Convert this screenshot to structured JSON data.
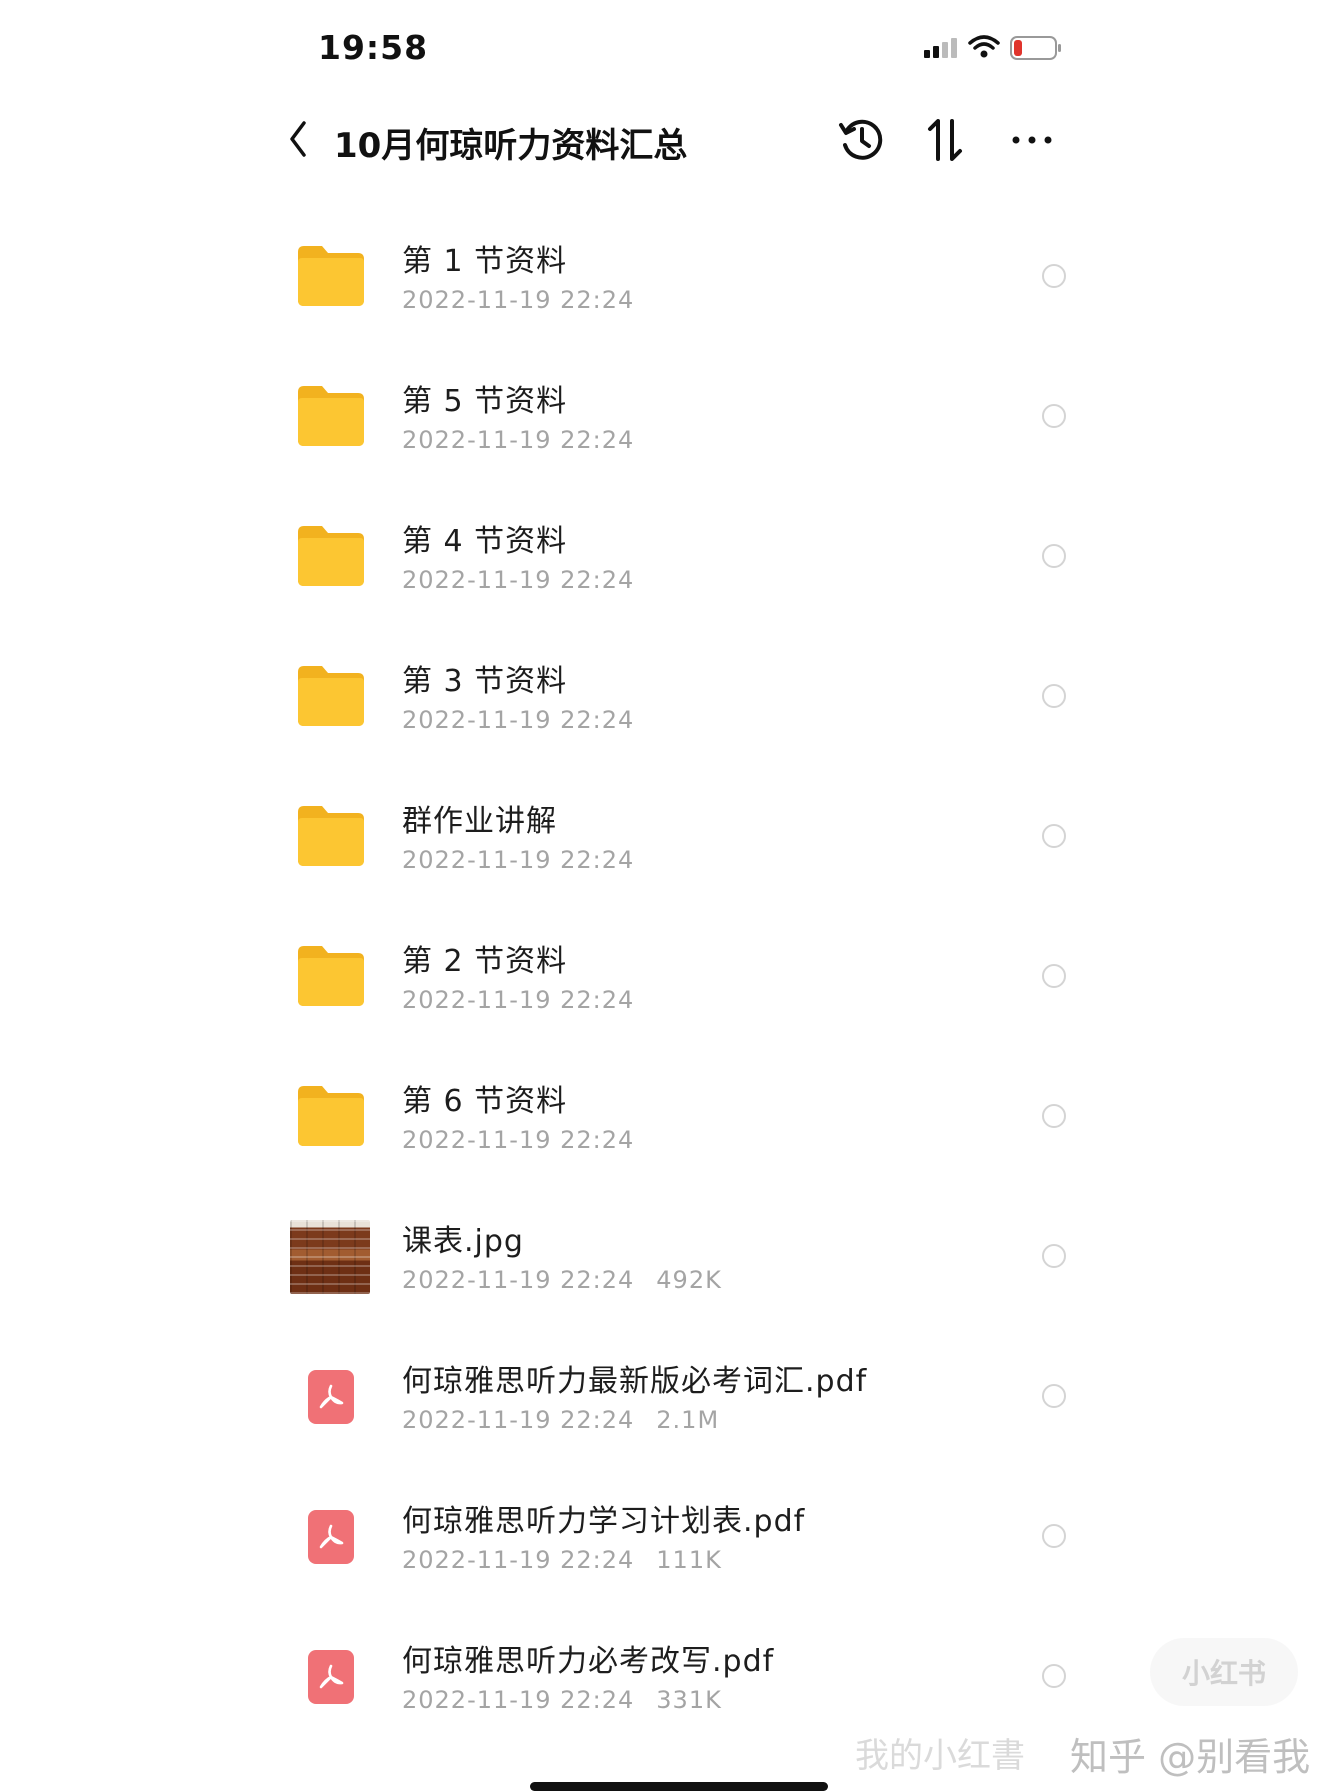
{
  "status_bar": {
    "time": "19:58",
    "battery_color": "#e0342c"
  },
  "nav": {
    "title": "10月何琼听力资料汇总",
    "icons": [
      "back-icon",
      "history-icon",
      "sort-icon",
      "more-icon"
    ]
  },
  "files": [
    {
      "name": "第 1 节资料",
      "date": "2022-11-19 22:24",
      "size": "",
      "type": "folder"
    },
    {
      "name": "第 5 节资料",
      "date": "2022-11-19 22:24",
      "size": "",
      "type": "folder"
    },
    {
      "name": "第 4 节资料",
      "date": "2022-11-19 22:24",
      "size": "",
      "type": "folder"
    },
    {
      "name": "第 3 节资料",
      "date": "2022-11-19 22:24",
      "size": "",
      "type": "folder"
    },
    {
      "name": "群作业讲解",
      "date": "2022-11-19 22:24",
      "size": "",
      "type": "folder"
    },
    {
      "name": "第 2 节资料",
      "date": "2022-11-19 22:24",
      "size": "",
      "type": "folder"
    },
    {
      "name": "第 6 节资料",
      "date": "2022-11-19 22:24",
      "size": "",
      "type": "folder"
    },
    {
      "name": "课表.jpg",
      "date": "2022-11-19 22:24",
      "size": "492K",
      "type": "image"
    },
    {
      "name": "何琼雅思听力最新版必考词汇.pdf",
      "date": "2022-11-19 22:24",
      "size": "2.1M",
      "type": "pdf"
    },
    {
      "name": "何琼雅思听力学习计划表.pdf",
      "date": "2022-11-19 22:24",
      "size": "111K",
      "type": "pdf"
    },
    {
      "name": "何琼雅思听力必考改写.pdf",
      "date": "2022-11-19 22:24",
      "size": "331K",
      "type": "pdf"
    }
  ],
  "colors": {
    "folder": "#fcc632",
    "pdf": "#f07176",
    "meta_text": "#a4a4a4"
  },
  "watermark": {
    "badge": "小红书",
    "text": "我的小红書",
    "text2": "知乎 @别看我"
  }
}
